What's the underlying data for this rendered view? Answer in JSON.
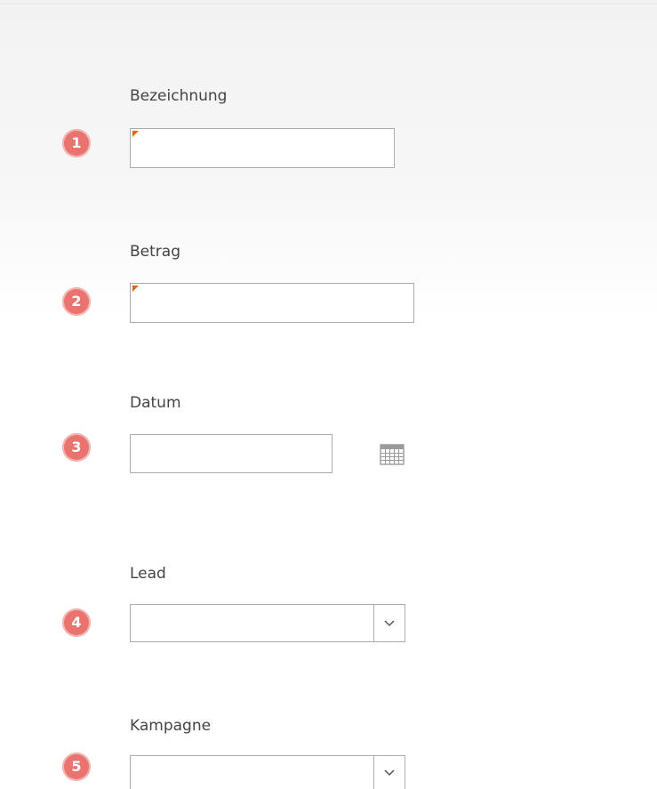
{
  "form": {
    "fields": [
      {
        "number": "1",
        "label": "Bezeichnung",
        "value": "",
        "required": true,
        "type": "text"
      },
      {
        "number": "2",
        "label": "Betrag",
        "value": "",
        "required": true,
        "type": "text"
      },
      {
        "number": "3",
        "label": "Datum",
        "value": "",
        "required": false,
        "type": "date",
        "icon": "calendar-icon"
      },
      {
        "number": "4",
        "label": "Lead",
        "value": "",
        "required": false,
        "type": "lookup",
        "icon": "chevron-down-icon"
      },
      {
        "number": "5",
        "label": "Kampagne",
        "value": "",
        "required": false,
        "type": "lookup",
        "icon": "chevron-down-icon"
      }
    ]
  },
  "colors": {
    "badge": "#e8736f",
    "required_marker": "#e2650f",
    "border": "#ababab",
    "label_text": "#444444"
  }
}
